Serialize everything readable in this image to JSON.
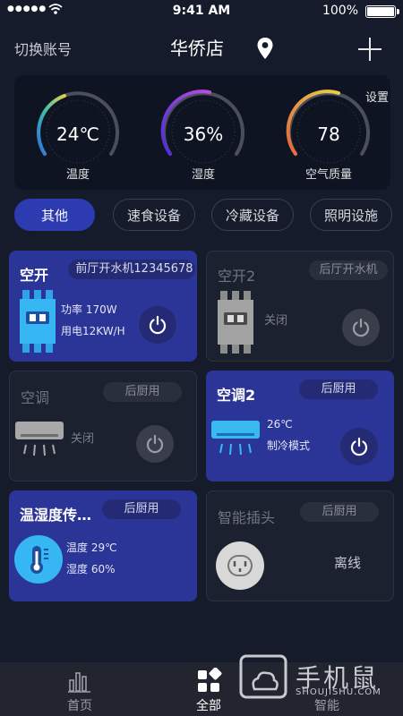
{
  "status_bar": {
    "time": "9:41 AM",
    "battery": "100%"
  },
  "header": {
    "switch_account": "切换账号",
    "store_name": "华侨店"
  },
  "gauges": {
    "settings": "设置",
    "items": [
      {
        "value": "24℃",
        "label": "温度",
        "level": 0.55
      },
      {
        "value": "36%",
        "label": "湿度",
        "level": 0.36
      },
      {
        "value": "78",
        "label": "空气质量",
        "level": 0.6
      }
    ]
  },
  "filters": [
    "其他",
    "速食设备",
    "冷藏设备",
    "照明设施"
  ],
  "devices": [
    {
      "title": "空开",
      "tag": "前厅开水机12345678",
      "line1": "功率 170W",
      "line2": "用电12KW/H"
    },
    {
      "title": "空开2",
      "tag": "后厅开水机",
      "line1": "关闭"
    },
    {
      "title": "空调",
      "tag": "后厨用",
      "line1": "关闭"
    },
    {
      "title": "空调2",
      "tag": "后厨用",
      "line1": "26℃",
      "line2": "制冷模式"
    },
    {
      "title": "温湿度传感器",
      "tag": "后厨用",
      "line1": "温度 29℃",
      "line2": "湿度 60%"
    },
    {
      "title": "智能插头",
      "tag": "后厨用",
      "line1": "离线"
    }
  ],
  "tabs": [
    "首页",
    "全部",
    "智能"
  ],
  "watermark": {
    "brand": "手机鼠",
    "url": "SHOUJISHU.COM"
  },
  "colors": {
    "accent": "#2c3bb0",
    "card_on": "#2b3497",
    "background": "#161b2b"
  }
}
